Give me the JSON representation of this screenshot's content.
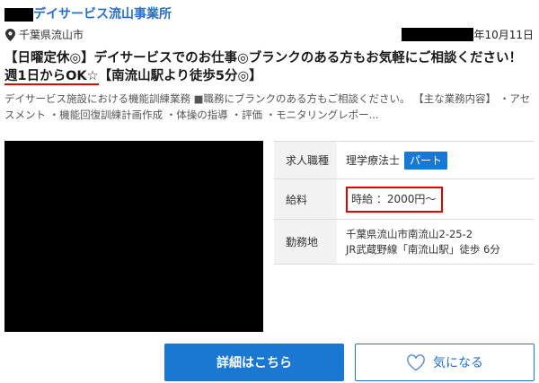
{
  "header": {
    "company_name": "デイサービス流山事業所",
    "location": "千葉県流山市",
    "posted_date": "年10月11日"
  },
  "title": {
    "line1": "【日曜定休◎】デイサービスでのお仕事◎ブランクのある方もお気軽にご相談ください！",
    "highlight": "週1日からOK☆",
    "suffix": "【南流山駅より徒歩5分◎】"
  },
  "description": "デイサービス施設における機能訓練業務 ■職務にブランクのある方もご相談ください。 【主な業務内容】 ・アセスメント ・機能回復訓練計画作成 ・体操の指導 ・評価 ・モニタリングレポー...",
  "details": {
    "job_type_label": "求人職種",
    "job_type_value": "理学療法士",
    "employment_badge": "パート",
    "salary_label": "給料",
    "salary_value": "時給 ：2000円〜",
    "location_label": "勤務地",
    "address": "千葉県流山市南流山2-25-2",
    "access": "JR武蔵野線「南流山駅」徒歩 6分"
  },
  "actions": {
    "detail_button": "詳細はこちら",
    "favorite_button": "気になる"
  },
  "icons": {
    "location": "map-pin-icon",
    "favorite": "heart-outline-icon"
  },
  "colors": {
    "accent": "#1a78d2",
    "link": "#2a6fc4",
    "annotation": "#e00000",
    "label_bg": "#f2f2f2"
  }
}
